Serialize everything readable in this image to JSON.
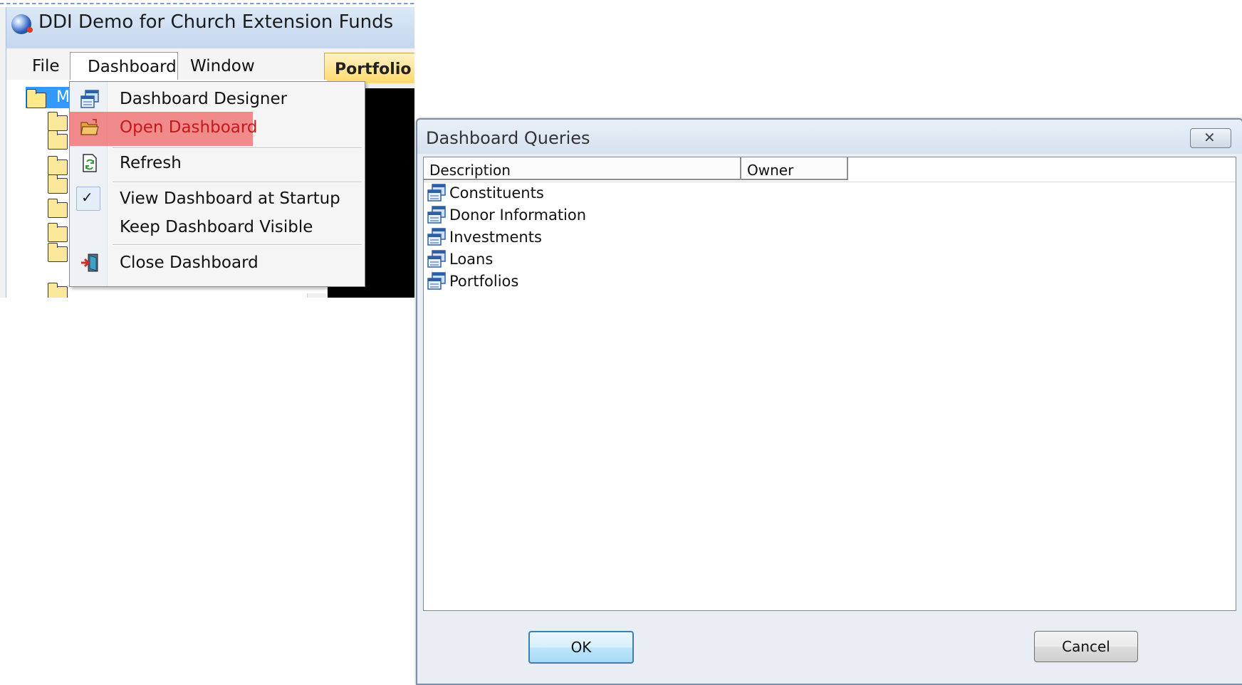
{
  "app": {
    "title": "DDI Demo for Church Extension Funds",
    "menu": {
      "file": "File",
      "dashboard": "Dashboard",
      "window": "Window"
    },
    "portfolio_tab": "Portfolio",
    "tree_selected": "M"
  },
  "dashboard_menu": {
    "items": [
      {
        "label": "Dashboard Designer",
        "icon": "dashboard-designer-icon"
      },
      {
        "label": "Open Dashboard",
        "icon": "open-folder-icon",
        "highlighted": true
      },
      {
        "label": "Refresh",
        "icon": "refresh-icon"
      },
      {
        "label": "View Dashboard at Startup",
        "icon": "checkmark-icon",
        "checked": true
      },
      {
        "label": "Keep Dashboard Visible",
        "icon": ""
      },
      {
        "label": "Close Dashboard",
        "icon": "exit-door-icon"
      }
    ],
    "highlight_color": "#f06b6b"
  },
  "dialog": {
    "title": "Dashboard Queries",
    "close_label": "✕",
    "columns": [
      "Description",
      "Owner"
    ],
    "rows": [
      {
        "description": "Constituents",
        "owner": ""
      },
      {
        "description": "Donor Information",
        "owner": ""
      },
      {
        "description": "Investments",
        "owner": ""
      },
      {
        "description": "Loans",
        "owner": ""
      },
      {
        "description": "Portfolios",
        "owner": ""
      }
    ],
    "ok_label": "OK",
    "cancel_label": "Cancel"
  }
}
